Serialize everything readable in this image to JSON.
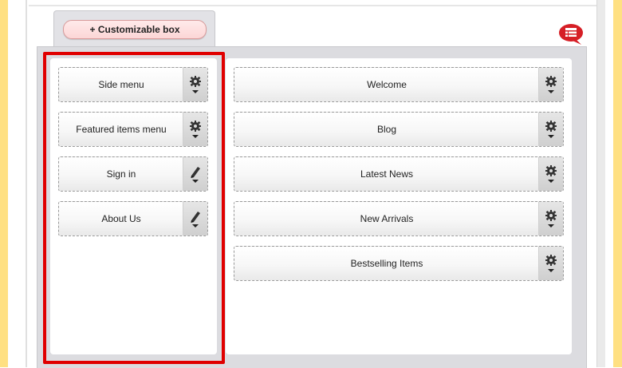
{
  "toolbar": {
    "add_box_label": "+ Customizable box"
  },
  "icons": {
    "layout": "layout-list-icon",
    "settings": "gear-icon",
    "edit": "pencil-icon",
    "dropdown": "caret-down-icon"
  },
  "colors": {
    "highlight": "#e00000",
    "add_button": "#fcd6d6",
    "panel_bg": "#dcdce0",
    "side_stripe": "#ffe082",
    "layout_icon": "#d61f26"
  },
  "left_column": {
    "blocks": [
      {
        "label": "Side menu",
        "icon": "gear-icon"
      },
      {
        "label": "Featured items menu",
        "icon": "gear-icon"
      },
      {
        "label": "Sign in",
        "icon": "pencil-icon"
      },
      {
        "label": "About Us",
        "icon": "pencil-icon"
      }
    ]
  },
  "right_column": {
    "blocks": [
      {
        "label": "Welcome",
        "icon": "gear-icon"
      },
      {
        "label": "Blog",
        "icon": "gear-icon"
      },
      {
        "label": "Latest News",
        "icon": "gear-icon"
      },
      {
        "label": "New Arrivals",
        "icon": "gear-icon"
      },
      {
        "label": "Bestselling Items",
        "icon": "gear-icon"
      }
    ]
  }
}
